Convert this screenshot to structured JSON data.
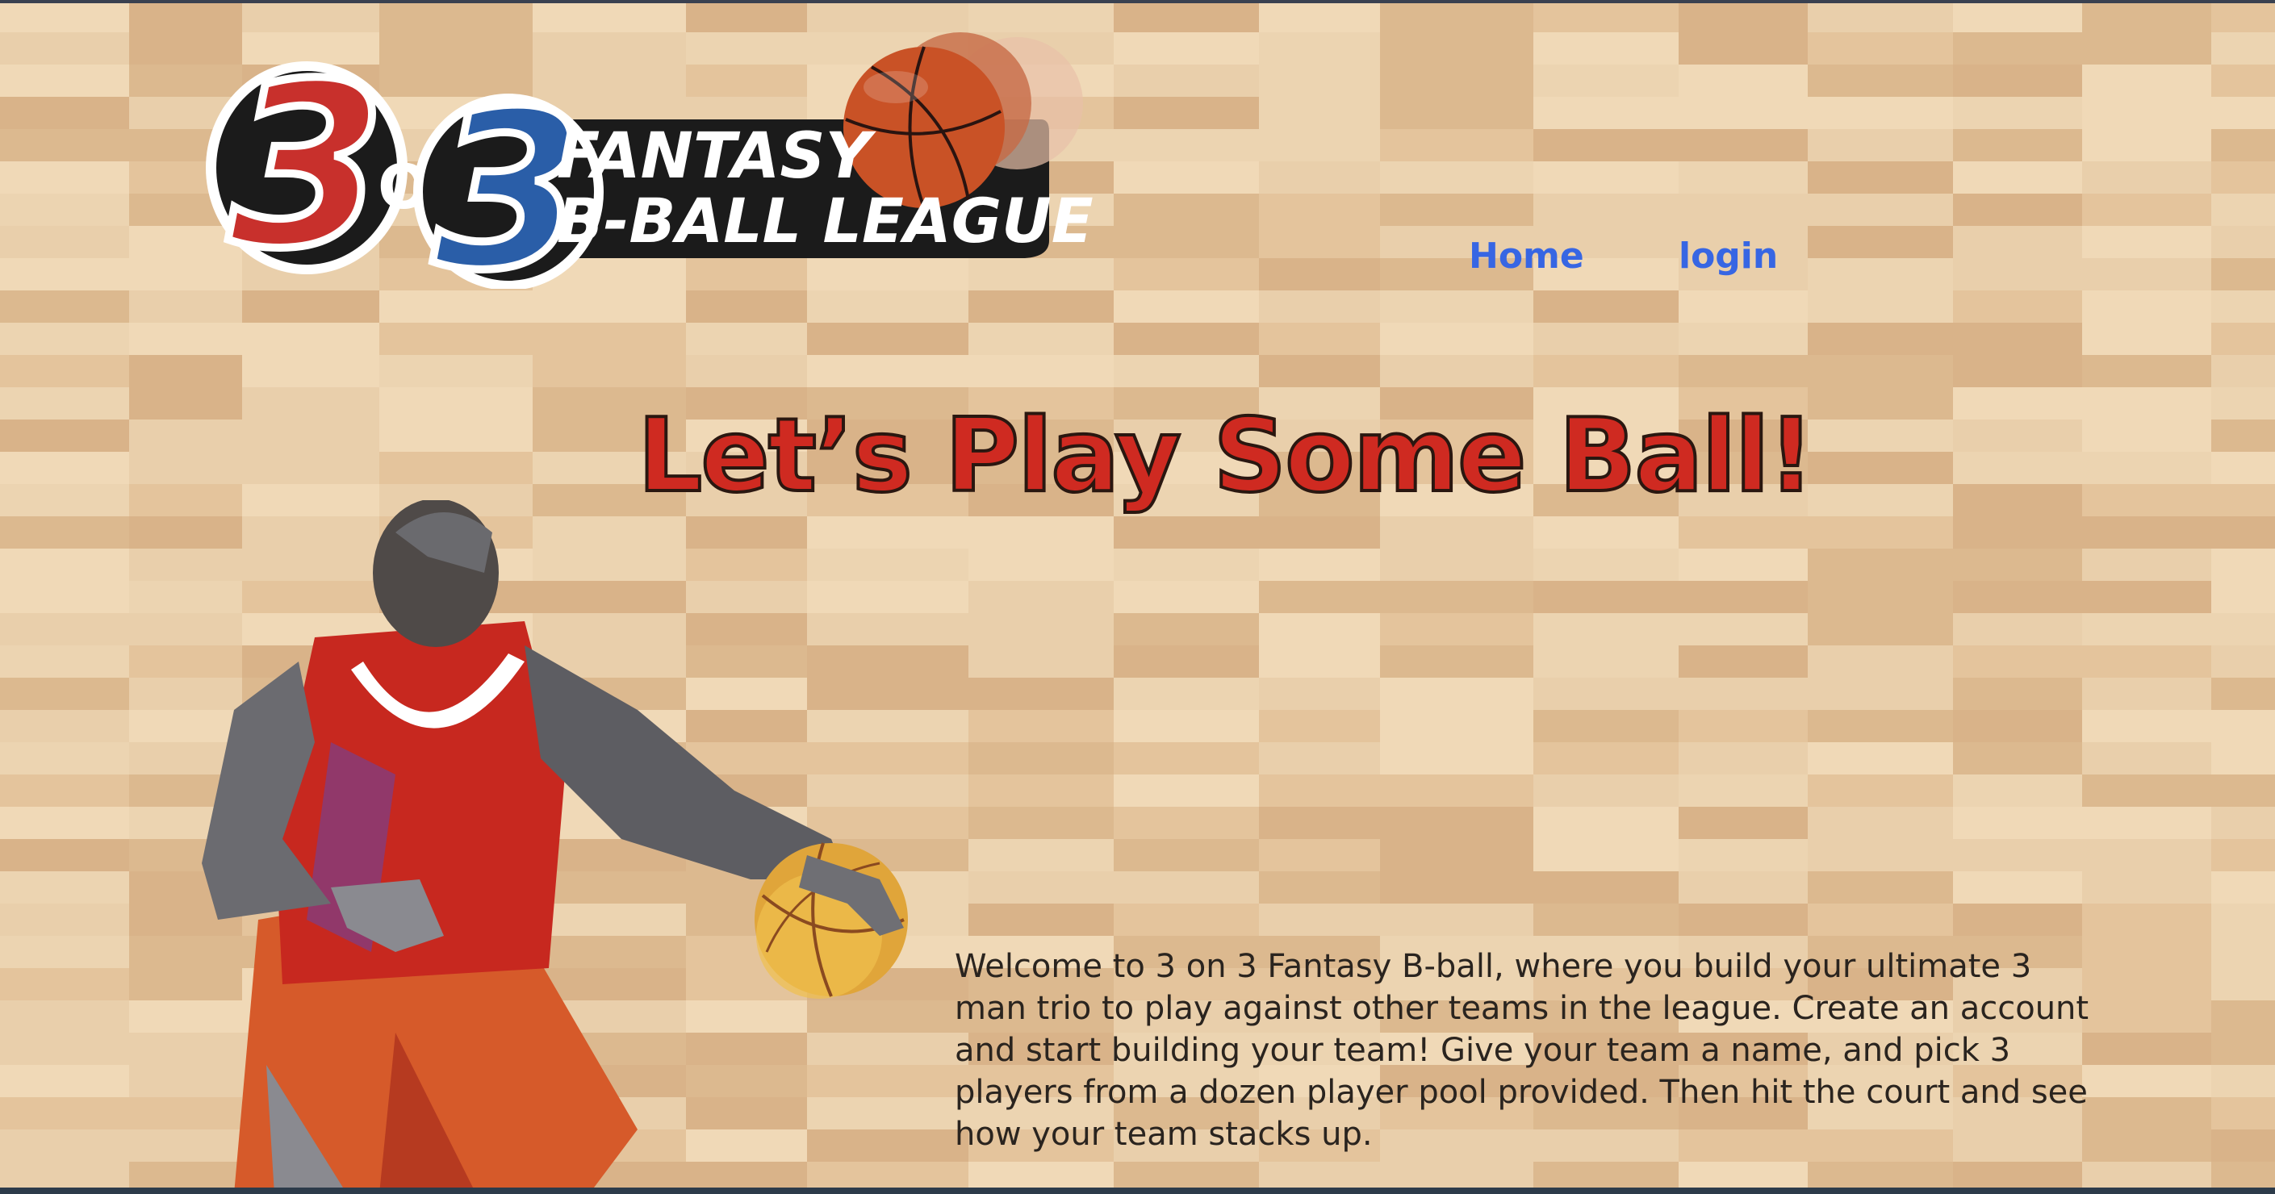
{
  "logo": {
    "big_three_left": "3",
    "on": "ON",
    "big_three_right": "3",
    "title_line1": "FANTASY",
    "title_line2": "B-BALL LEAGUE"
  },
  "nav": {
    "home": "Home",
    "login": "login"
  },
  "hero": {
    "headline": "Let’s Play Some Ball!"
  },
  "intro": {
    "text": "Welcome to 3 on 3 Fantasy B-ball, where you build your ultimate 3 man trio to play against other teams in the league. Create an account and start building your team! Give your team a name, and pick 3 players from a dozen player pool provided. Then hit the court and see how your team stacks up."
  },
  "colors": {
    "nav_link": "#3766e3",
    "headline": "#cf2a21",
    "floor_light": "#ead2ae",
    "floor_dark": "#d6b48a",
    "logo_red": "#c8302c",
    "logo_blue": "#2a5ea8"
  }
}
